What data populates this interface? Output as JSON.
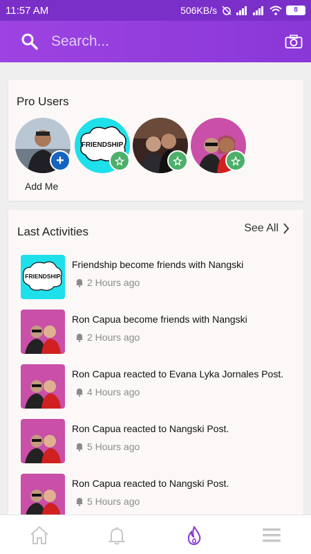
{
  "status_bar": {
    "time": "11:57 AM",
    "speed": "506KB/s",
    "battery": "8"
  },
  "search": {
    "placeholder": "Search..."
  },
  "pro_users": {
    "title": "Pro Users",
    "add_label": "Add Me",
    "users": [
      {
        "avatar": "man-photo",
        "badge": "plus-icon"
      },
      {
        "avatar": "friendship-logo",
        "badge": "sparkle-star-icon"
      },
      {
        "avatar": "couple-restaurant-photo",
        "badge": "sparkle-star-icon"
      },
      {
        "avatar": "couple-christmas-photo",
        "badge": "sparkle-star-icon"
      }
    ]
  },
  "activities": {
    "title": "Last Activities",
    "see_all": "See All",
    "items": [
      {
        "text": "Friendship become friends with Nangski",
        "time": "2 Hours ago",
        "thumb": "friendship-logo"
      },
      {
        "text": "Ron Capua become friends with Nangski",
        "time": "2 Hours ago",
        "thumb": "couple-christmas-photo"
      },
      {
        "text": "Ron Capua reacted to Evana Lyka Jornales Post.",
        "time": "4 Hours ago",
        "thumb": "couple-christmas-photo"
      },
      {
        "text": "Ron Capua reacted to Nangski Post.",
        "time": "5 Hours ago",
        "thumb": "couple-christmas-photo"
      },
      {
        "text": "Ron Capua reacted to Nangski Post.",
        "time": "5 Hours ago",
        "thumb": "couple-christmas-photo"
      }
    ]
  },
  "bottom_nav": [
    {
      "icon": "home-icon"
    },
    {
      "icon": "bell-icon"
    },
    {
      "icon": "flame-icon",
      "active": true
    },
    {
      "icon": "menu-icon"
    }
  ],
  "colors": {
    "accent": "#8a37d8",
    "status_bar": "#7b2fc9",
    "plus_badge": "#1565c0",
    "star_badge": "#4caf6a"
  }
}
